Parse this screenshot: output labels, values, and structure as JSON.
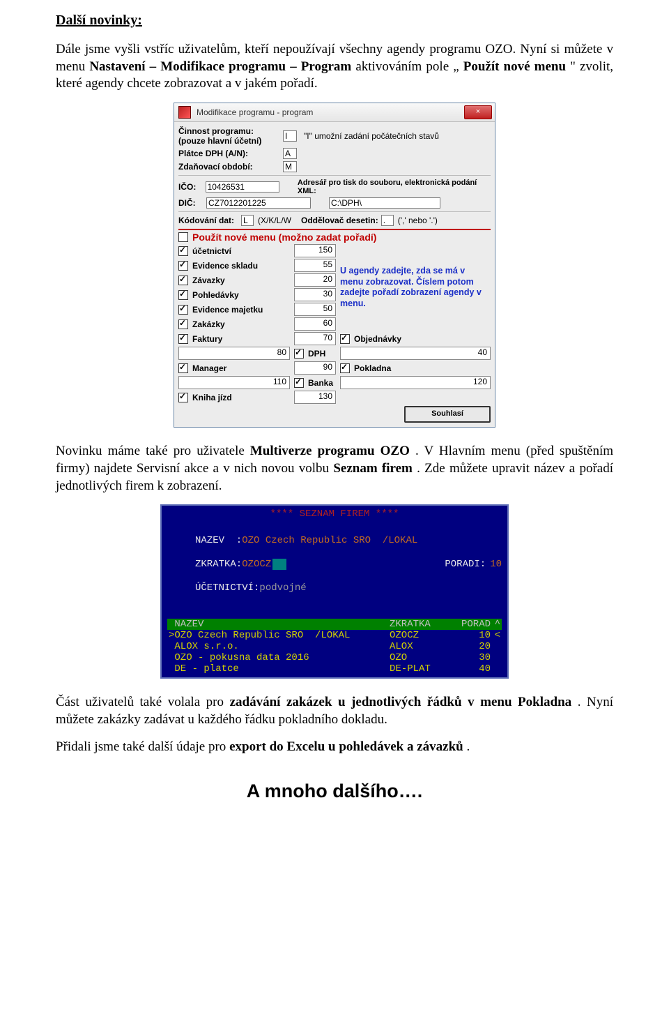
{
  "heading": "Další novinky:",
  "para1_a": "Dále jsme vyšli vstříc uživatelům, kteří nepoužívají všechny agendy programu OZO. Nyní si můžete v menu ",
  "para1_b": "Nastavení – Modifikace programu – Program",
  "para1_c": " aktivováním pole „",
  "para1_d": "Použít nové menu",
  "para1_e": "\" zvolit, které agendy chcete zobrazovat a v jakém pořadí.",
  "dialog1": {
    "title": "Modifikace programu - program",
    "close": "×",
    "lbl_cinnost1": "Činnost programu:",
    "lbl_cinnost2": "(pouze hlavní účetní)",
    "val_cinnost": "I",
    "hint_cinnost": "\"I\" umožní zadání počátečních stavů",
    "lbl_platce": "Plátce DPH (A/N):",
    "val_platce": "A",
    "lbl_zdanperiod": "Zdaňovací období:",
    "val_zdanperiod": "M",
    "lbl_ico": "IČO:",
    "val_ico": "10426531",
    "lbl_adr": "Adresář pro tisk do souboru, elektronická podání XML:",
    "lbl_dic": "DIČ:",
    "val_dic": "CZ7012201225",
    "val_adr": "C:\\DPH\\",
    "lbl_kod": "Kódování dat:",
    "val_kod": "L",
    "hint_kod": "(X/K/L/W",
    "lbl_odd": "Oddělovač desetin:",
    "val_odd": ".",
    "hint_odd": "(',' nebo '.')",
    "new_menu": "Použít nové menu (možno zadat pořadí)",
    "side_text": "U agendy zadejte, zda se má v menu zobrazovat. Číslem potom zadejte pořadí zobrazení agendy v menu.",
    "souhlasi": "Souhlasí",
    "agendas": [
      {
        "label": "účetnictví",
        "val": "150"
      },
      {
        "label": "Evidence skladu",
        "val": "55"
      },
      {
        "label": "Závazky",
        "val": "20"
      },
      {
        "label": "Pohledávky",
        "val": "30"
      },
      {
        "label": "Evidence majetku",
        "val": "50"
      },
      {
        "label": "Zakázky",
        "val": "60"
      },
      {
        "label": "Faktury",
        "val": "70"
      },
      {
        "label": "Objednávky",
        "val": "80"
      },
      {
        "label": "DPH",
        "val": "40"
      },
      {
        "label": "Manager",
        "val": "90"
      },
      {
        "label": "Pokladna",
        "val": "110"
      },
      {
        "label": "Banka",
        "val": "120"
      },
      {
        "label": "Kniha jízd",
        "val": "130"
      }
    ]
  },
  "para2_a": "Novinku máme také pro uživatele ",
  "para2_b": "Multiverze programu OZO",
  "para2_c": ". V Hlavním menu (před spuštěním firmy) najdete Servisní akce a v nich novou volbu ",
  "para2_d": "Seznam firem",
  "para2_e": ". Zde můžete upravit název a pořadí jednotlivých firem k zobrazení.",
  "dos": {
    "title": "****  SEZNAM FIREM ****",
    "f_nazev_lbl": "NAZEV  :",
    "f_nazev_val": "OZO Czech Republic SRO  /LOKAL",
    "f_zkr_lbl": "ZKRATKA:",
    "f_zkr_val": "OZOCZ",
    "f_poradi_lbl": "PORADI:",
    "f_poradi_val": "10",
    "f_ucet_lbl": "ÚČETNICTVÍ:",
    "f_ucet_val": "podvojné",
    "col_nazev": "NAZEV",
    "col_zkr": "ZKRATKA",
    "col_porad": "PORAD",
    "col_caret": "^",
    "rows": [
      {
        "sel": true,
        "n": "OZO Czech Republic SRO  /LOKAL",
        "z": "OZOCZ",
        "p": "10"
      },
      {
        "sel": false,
        "n": "ALOX s.r.o.",
        "z": "ALOX",
        "p": "20"
      },
      {
        "sel": false,
        "n": "OZO - pokusna data 2016",
        "z": "OZO",
        "p": "30"
      },
      {
        "sel": false,
        "n": "DE - platce",
        "z": "DE-PLAT",
        "p": "40"
      }
    ]
  },
  "para3_a": "Část uživatelů také volala pro ",
  "para3_b": "zadávání zakázek u jednotlivých řádků v menu Pokladna",
  "para3_c": ". Nyní můžete zakázky zadávat u každého řádku pokladního dokladu.",
  "para4_a": "Přidali jsme také další údaje pro ",
  "para4_b": "export do Excelu u pohledávek a závazků",
  "para4_c": ".",
  "bottom": "A mnoho dalšího…."
}
